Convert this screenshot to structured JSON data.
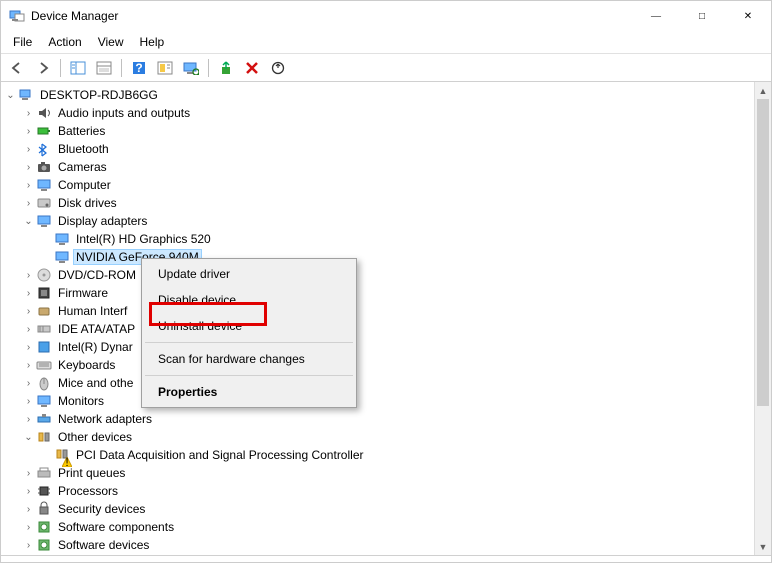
{
  "window": {
    "title": "Device Manager"
  },
  "menu": {
    "file": "File",
    "action": "Action",
    "view": "View",
    "help": "Help"
  },
  "tree": {
    "root": "DESKTOP-RDJB6GG",
    "nodes": [
      {
        "id": "audio",
        "label": "Audio inputs and outputs",
        "exp": ">"
      },
      {
        "id": "batteries",
        "label": "Batteries",
        "exp": ">"
      },
      {
        "id": "bluetooth",
        "label": "Bluetooth",
        "exp": ">"
      },
      {
        "id": "cameras",
        "label": "Cameras",
        "exp": ">"
      },
      {
        "id": "computer",
        "label": "Computer",
        "exp": ">"
      },
      {
        "id": "disk",
        "label": "Disk drives",
        "exp": ">"
      },
      {
        "id": "display",
        "label": "Display adapters",
        "exp": "v",
        "children": [
          {
            "id": "intel",
            "label": "Intel(R) HD Graphics 520"
          },
          {
            "id": "nvidia",
            "label": "NVIDIA GeForce 940M",
            "selected": true
          }
        ]
      },
      {
        "id": "dvd",
        "label": "DVD/CD-ROM",
        "exp": ">"
      },
      {
        "id": "firmware",
        "label": "Firmware",
        "exp": ">"
      },
      {
        "id": "hid",
        "label": "Human Interf",
        "exp": ">"
      },
      {
        "id": "ide",
        "label": "IDE ATA/ATAP",
        "exp": ">"
      },
      {
        "id": "dynamic",
        "label": "Intel(R) Dynar",
        "exp": ">"
      },
      {
        "id": "keyboards",
        "label": "Keyboards",
        "exp": ">"
      },
      {
        "id": "mice",
        "label": "Mice and othe",
        "exp": ">"
      },
      {
        "id": "monitors",
        "label": "Monitors",
        "exp": ">"
      },
      {
        "id": "network",
        "label": "Network adapters",
        "exp": ">"
      },
      {
        "id": "other",
        "label": "Other devices",
        "exp": "v",
        "children": [
          {
            "id": "pci",
            "label": "PCI Data Acquisition and Signal Processing Controller",
            "warn": true
          }
        ]
      },
      {
        "id": "printq",
        "label": "Print queues",
        "exp": ">"
      },
      {
        "id": "processors",
        "label": "Processors",
        "exp": ">"
      },
      {
        "id": "security",
        "label": "Security devices",
        "exp": ">"
      },
      {
        "id": "swcomp",
        "label": "Software components",
        "exp": ">"
      },
      {
        "id": "swdev",
        "label": "Software devices",
        "exp": ">"
      }
    ]
  },
  "context_menu": {
    "update": "Update driver",
    "disable": "Disable device",
    "uninstall": "Uninstall device",
    "scan": "Scan for hardware changes",
    "properties": "Properties"
  }
}
